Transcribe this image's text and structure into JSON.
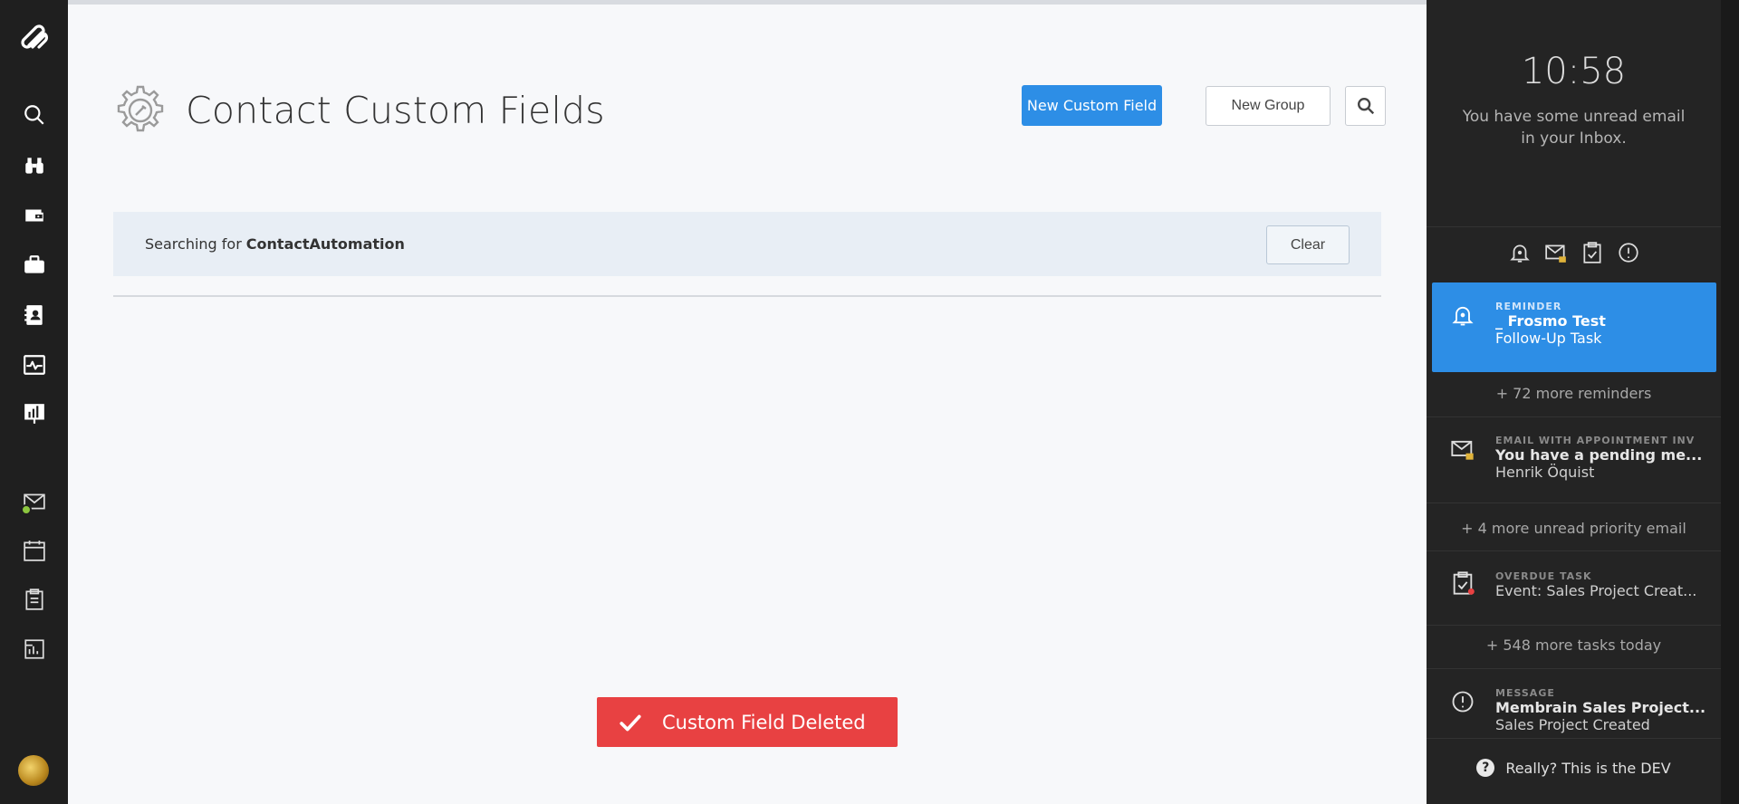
{
  "page": {
    "title": "Contact Custom Fields",
    "new_field_label": "New Custom Field",
    "new_group_label": "New Group"
  },
  "search": {
    "prefix": "Searching for",
    "term": "ContactAutomation",
    "clear_label": "Clear"
  },
  "toast": {
    "message": "Custom Field Deleted"
  },
  "sidebar": {
    "icons": [
      "search-icon",
      "binoculars-icon",
      "wallet-icon",
      "briefcase-icon",
      "contacts-icon",
      "activity-icon",
      "presentation-icon",
      "mail-icon",
      "calendar-icon",
      "clipboard-icon",
      "report-icon"
    ]
  },
  "right_panel": {
    "time": "10:58",
    "message": "You have some unread email in your Inbox.",
    "filters": [
      "bell-icon",
      "mail-lock-icon",
      "clipboard-check-icon",
      "info-icon"
    ],
    "items": [
      {
        "category": "REMINDER",
        "title": "_ Frosmo Test",
        "subtitle": "Follow-Up Task"
      },
      {
        "category": "EMAIL WITH APPOINTMENT INV",
        "title": "You have a pending me...",
        "subtitle": "Henrik Öquist"
      },
      {
        "category": "OVERDUE TASK",
        "title": "",
        "subtitle": "Event: Sales Project Creat..."
      },
      {
        "category": "MESSAGE",
        "title": "Membrain Sales Project...",
        "subtitle": "Sales Project Created"
      }
    ],
    "more": {
      "reminders": "+ 72 more reminders",
      "email": "+ 4 more unread priority email",
      "tasks": "+ 548 more tasks today"
    },
    "help_text": "Really? This is the DEV"
  },
  "colors": {
    "accent": "#2d8ee6",
    "toast": "#e84142",
    "nav_bg": "#1f1f1f",
    "panel_bg": "#242424"
  }
}
